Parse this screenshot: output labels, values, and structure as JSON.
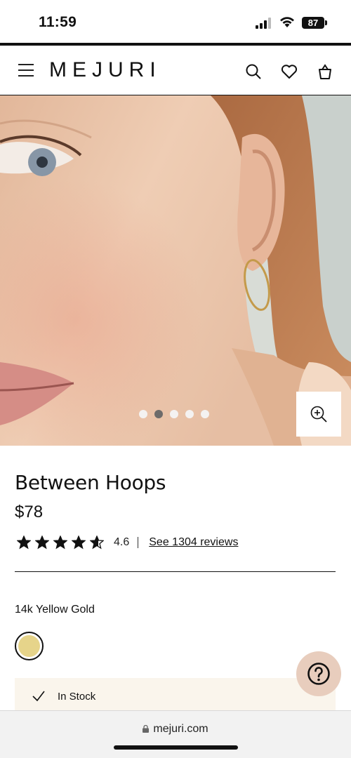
{
  "status_bar": {
    "time": "11:59",
    "battery": "87",
    "icons": [
      "cellular-signal-icon",
      "wifi-icon",
      "battery-icon"
    ]
  },
  "header": {
    "logo": "MEJURI",
    "icons": [
      "menu-icon",
      "search-icon",
      "heart-icon",
      "bag-icon"
    ]
  },
  "gallery": {
    "image_count": 5,
    "active_index": 1,
    "zoom_icon": "zoom-in-icon"
  },
  "product": {
    "title": "Between Hoops",
    "price": "$78",
    "rating": "4.6",
    "rating_value": 4.6,
    "rating_max": 5,
    "reviews_link": "See 1304 reviews",
    "variant_label": "14k Yellow Gold",
    "swatch_color": "#e6d48a",
    "stock_status": "In Stock"
  },
  "help_button": {
    "icon": "question-icon",
    "color": "#e8cdbd"
  },
  "browser": {
    "url": "mejuri.com"
  }
}
